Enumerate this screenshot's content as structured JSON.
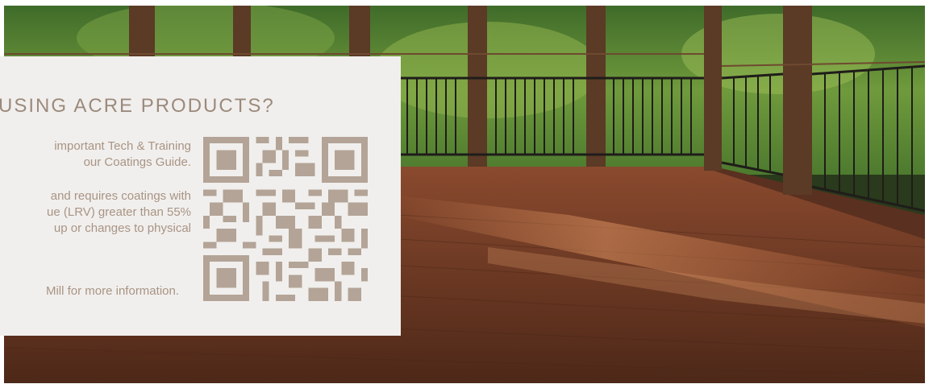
{
  "card": {
    "title": "USING ACRE PRODUCTS?",
    "paragraph1_line1": "important Tech & Training",
    "paragraph1_line2": "our Coatings Guide.",
    "paragraph2_line1": "and requires coatings with",
    "paragraph2_line2": "ue (LRV) greater than 55%",
    "paragraph2_line3": "up or changes to physical",
    "paragraph3": "Mill for more information."
  },
  "colors": {
    "card_background": "#f1efed",
    "title_text": "#9b8a7c",
    "body_text": "#a89484",
    "qr_code": "#b3a497"
  },
  "icons": {
    "qr": "qr-code-icon"
  }
}
